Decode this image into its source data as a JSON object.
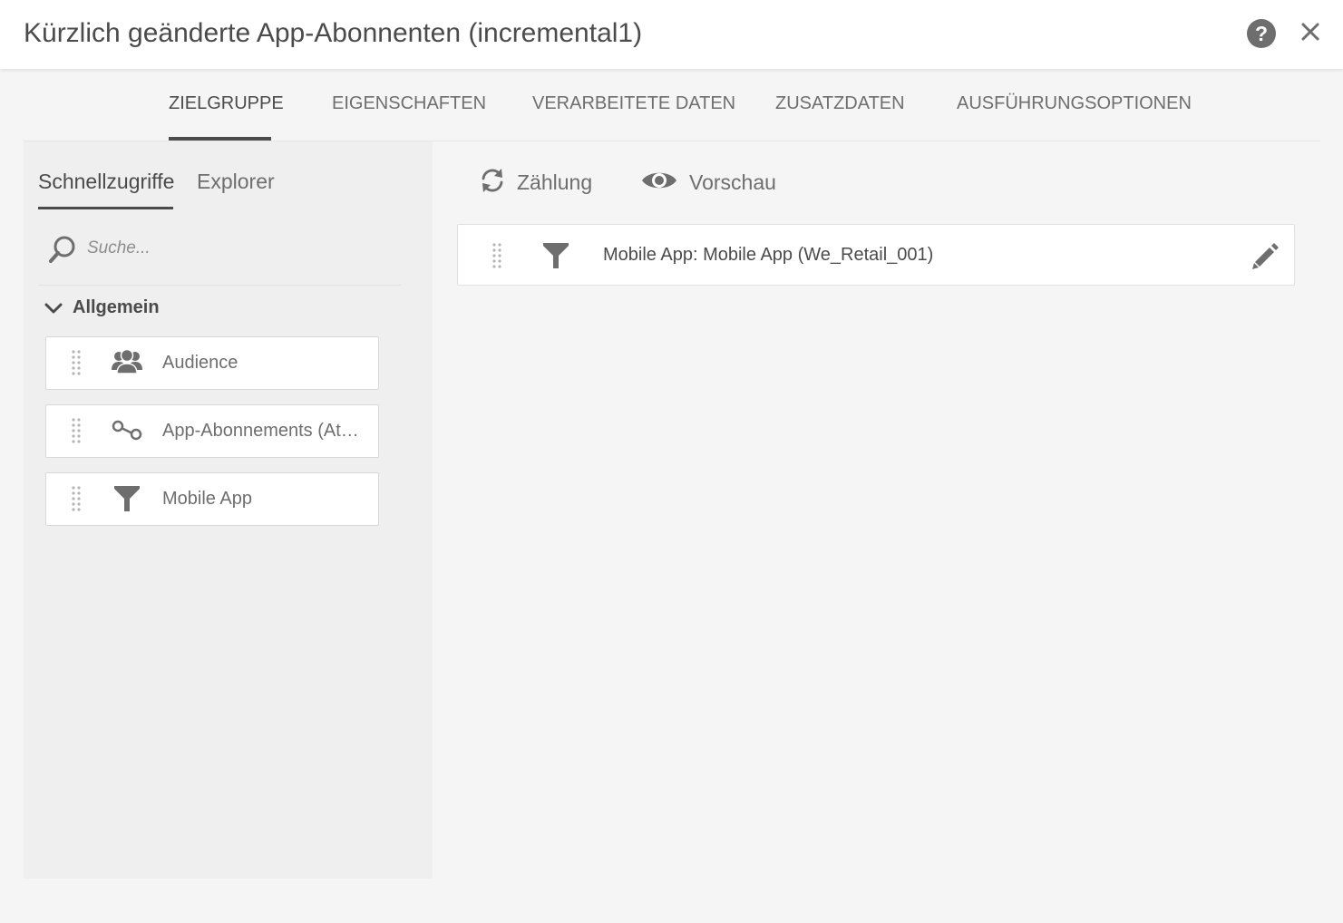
{
  "window": {
    "title": "Kürzlich geänderte App-Abonnenten (incremental1)",
    "help_icon": "help-circle-icon",
    "help_glyph": "?",
    "close_icon": "close-icon"
  },
  "tabs": [
    {
      "label": "ZIELGRUPPE",
      "active": true
    },
    {
      "label": "EIGENSCHAFTEN",
      "active": false
    },
    {
      "label": "VERARBEITETE DATEN",
      "active": false
    },
    {
      "label": "ZUSATZDATEN",
      "active": false
    },
    {
      "label": "AUSFÜHRUNGSOPTIONEN",
      "active": false
    }
  ],
  "left_panel": {
    "subtabs": [
      {
        "label": "Schnellzugriffe",
        "active": true
      },
      {
        "label": "Explorer",
        "active": false
      }
    ],
    "search": {
      "placeholder": "Suche...",
      "value": "",
      "icon": "search-icon"
    },
    "group": {
      "label": "Allgemein",
      "expanded": true,
      "items": [
        {
          "label": "Audience",
          "icon": "audience-icon"
        },
        {
          "label": "App-Abonnements (Attribut)",
          "icon": "link-icon"
        },
        {
          "label": "Mobile App",
          "icon": "filter-icon"
        }
      ]
    }
  },
  "right_panel": {
    "actions": [
      {
        "label": "Zählung",
        "icon": "refresh-icon"
      },
      {
        "label": "Vorschau",
        "icon": "eye-icon"
      }
    ],
    "rules": [
      {
        "label": "Mobile App: Mobile App (We_Retail_001)",
        "icon": "filter-icon",
        "edit_icon": "pencil-icon"
      }
    ]
  },
  "colors": {
    "text": "#4b4b4b",
    "muted_text": "#6e6e6e",
    "background": "#f5f5f5",
    "panel": "#efefef",
    "card": "#ffffff"
  }
}
